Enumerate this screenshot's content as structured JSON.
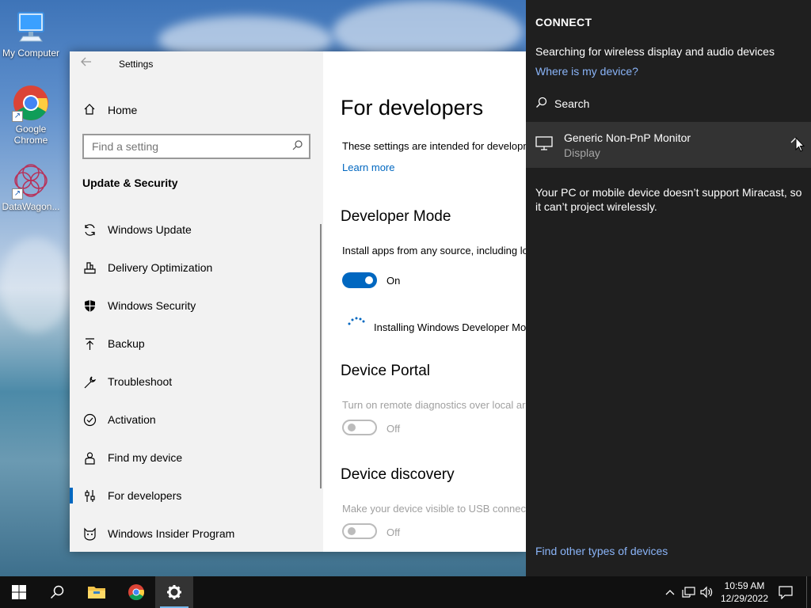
{
  "desktop": {
    "icons": [
      {
        "label": "My Computer"
      },
      {
        "label": "Google Chrome"
      },
      {
        "label": "DataWagon..."
      }
    ]
  },
  "settings": {
    "window_title": "Settings",
    "home_label": "Home",
    "search_placeholder": "Find a setting",
    "section_title": "Update & Security",
    "nav_items": [
      {
        "label": "Windows Update",
        "icon": "sync-icon"
      },
      {
        "label": "Delivery Optimization",
        "icon": "delivery-optimization-icon"
      },
      {
        "label": "Windows Security",
        "icon": "shield-icon"
      },
      {
        "label": "Backup",
        "icon": "backup-icon"
      },
      {
        "label": "Troubleshoot",
        "icon": "wrench-icon"
      },
      {
        "label": "Activation",
        "icon": "check-circle-icon"
      },
      {
        "label": "Find my device",
        "icon": "person-pin-icon"
      },
      {
        "label": "For developers",
        "icon": "developer-icon",
        "selected": true
      },
      {
        "label": "Windows Insider Program",
        "icon": "insider-cat-icon"
      }
    ],
    "content": {
      "title": "For developers",
      "intro": "These settings are intended for development use only.",
      "learn_more": "Learn more",
      "developer_mode": {
        "heading": "Developer Mode",
        "description": "Install apps from any source, including loose files.",
        "state": "On",
        "installing": "Installing Windows Developer Mode package"
      },
      "device_portal": {
        "heading": "Device Portal",
        "description": "Turn on remote diagnostics over local area network connections.",
        "state": "Off"
      },
      "device_discovery": {
        "heading": "Device discovery",
        "description": "Make your device visible to USB connections and your local network.",
        "state": "Off"
      }
    }
  },
  "connect": {
    "title": "CONNECT",
    "searching": "Searching for wireless display and audio devices",
    "where_link": "Where is my device?",
    "search_label": "Search",
    "device": {
      "name": "Generic Non-PnP Monitor",
      "type": "Display"
    },
    "note": "Your PC or mobile device doesn’t support Miracast, so it can’t project wirelessly.",
    "other_link": "Find other types of devices"
  },
  "taskbar": {
    "time": "10:59 AM",
    "date": "12/29/2022"
  },
  "colors": {
    "accent": "#0067c0",
    "connect_bg": "#1f1f1f",
    "connect_link": "#8ab4f8",
    "taskbar_bg": "#101010"
  }
}
